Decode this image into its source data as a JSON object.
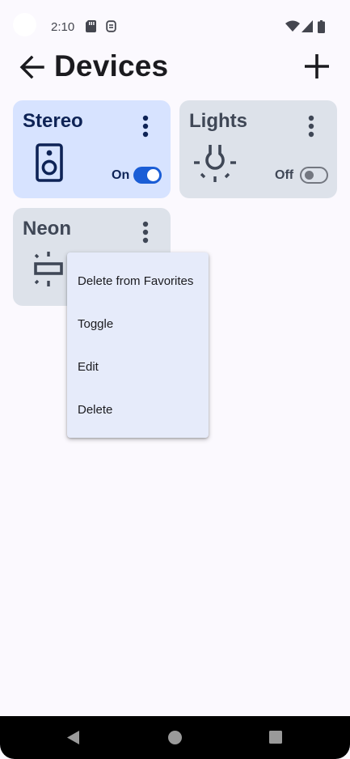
{
  "status_bar": {
    "time": "2:10"
  },
  "app_bar": {
    "title": "Devices"
  },
  "devices": [
    {
      "name": "Stereo",
      "state": "On",
      "is_on": true,
      "icon": "speaker-icon"
    },
    {
      "name": "Lights",
      "state": "Off",
      "is_on": false,
      "icon": "light-bulb-icon"
    },
    {
      "name": "Neon",
      "icon": "neon-light-icon"
    }
  ],
  "context_menu": {
    "items": [
      "Delete from Favorites",
      "Toggle",
      "Edit",
      "Delete"
    ]
  },
  "colors": {
    "background": "#fbf9fe",
    "card_on": "#d7e3ff",
    "card_off": "#dde2ea",
    "switch_on": "#1a5dd6",
    "menu_surface": "#e6ebfa"
  }
}
